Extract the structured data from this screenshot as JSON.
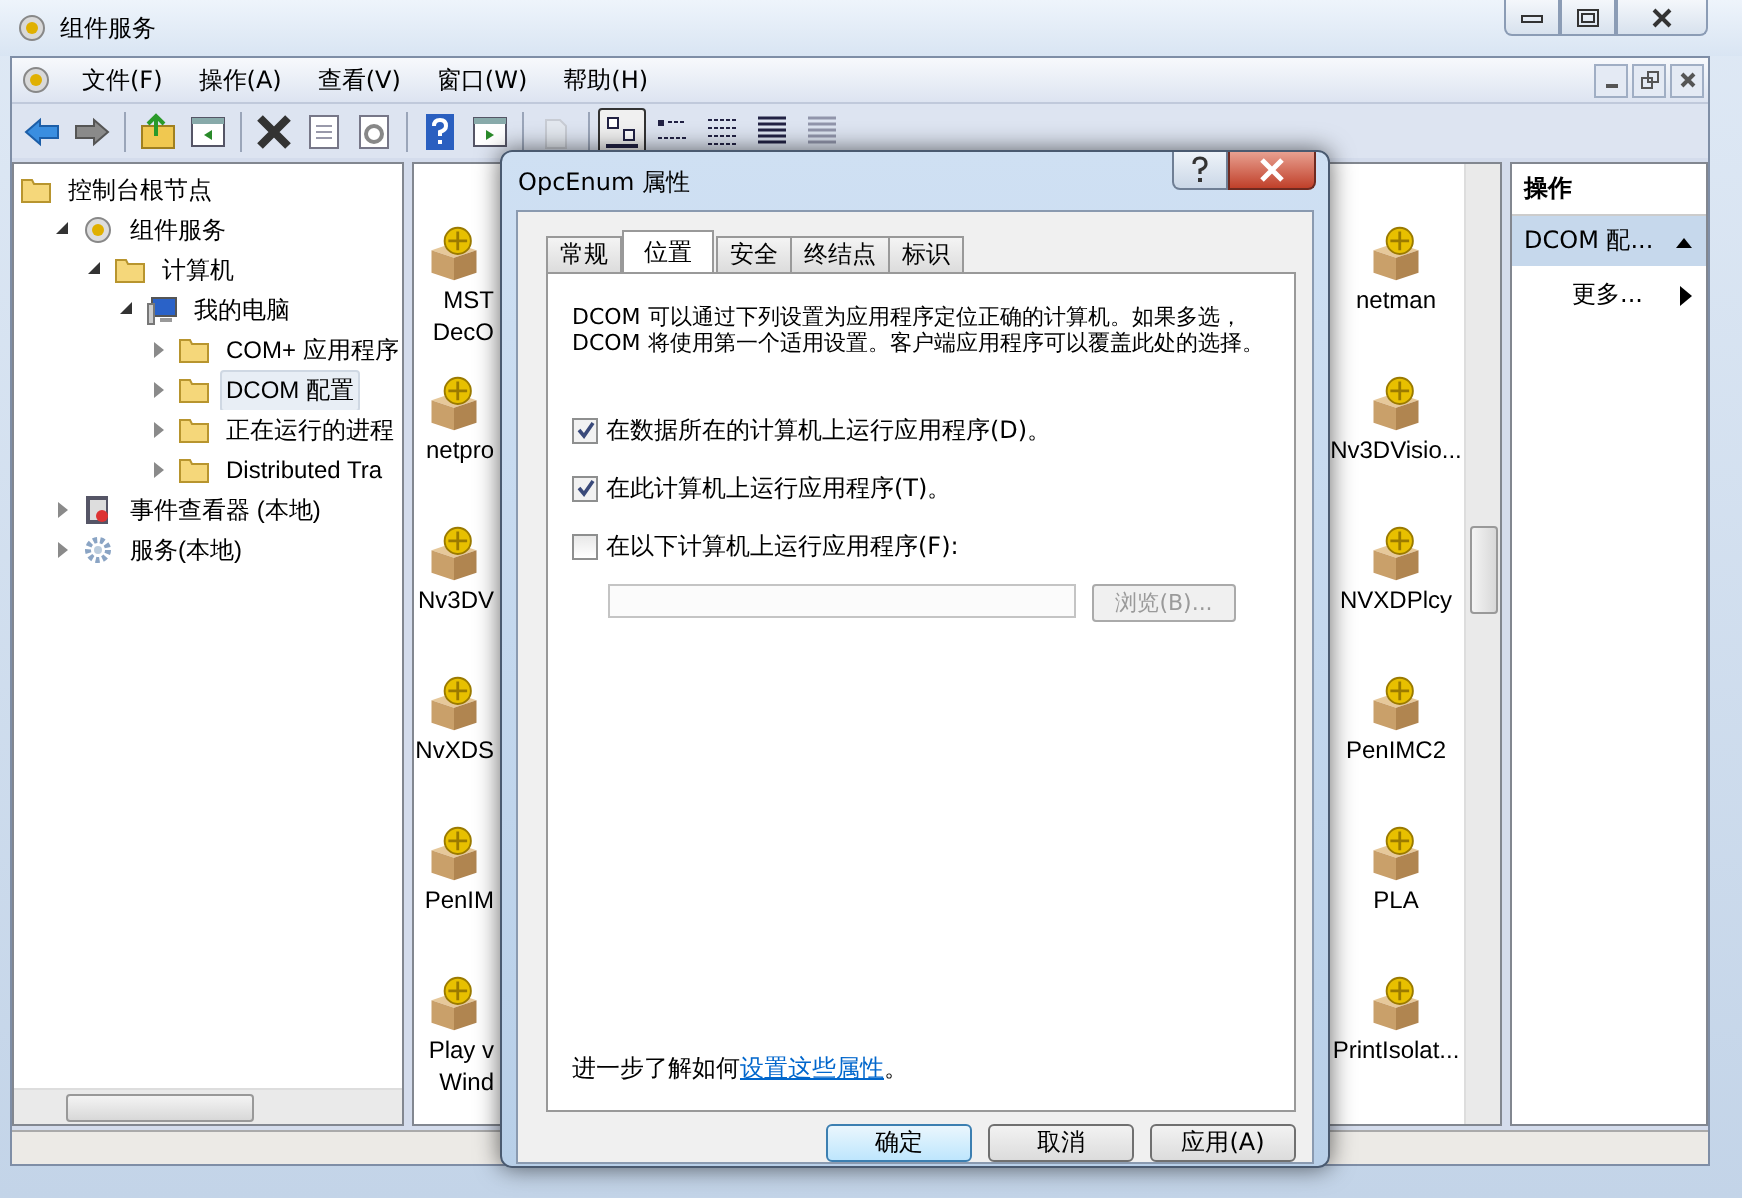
{
  "window": {
    "title": "组件服务"
  },
  "menu": [
    "文件(F)",
    "操作(A)",
    "查看(V)",
    "窗口(W)",
    "帮助(H)"
  ],
  "toolbar": [
    {
      "kind": "back",
      "disabled": false
    },
    {
      "kind": "forward",
      "disabled": false
    },
    {
      "kind": "sep"
    },
    {
      "kind": "up",
      "disabled": false
    },
    {
      "kind": "tree",
      "disabled": false
    },
    {
      "kind": "sep"
    },
    {
      "kind": "delete",
      "disabled": false
    },
    {
      "kind": "properties",
      "disabled": false
    },
    {
      "kind": "refresh",
      "disabled": false
    },
    {
      "kind": "sep"
    },
    {
      "kind": "help",
      "disabled": false
    },
    {
      "kind": "actionpane",
      "disabled": false
    },
    {
      "kind": "sep"
    },
    {
      "kind": "new",
      "disabled": true
    },
    {
      "kind": "sep"
    }
  ],
  "view_buttons": [
    {
      "kind": "large",
      "selected": true,
      "disabled": false
    },
    {
      "kind": "small",
      "selected": false,
      "disabled": false
    },
    {
      "kind": "list",
      "selected": false,
      "disabled": false
    },
    {
      "kind": "detail",
      "selected": false,
      "disabled": false
    },
    {
      "kind": "detail",
      "selected": false,
      "disabled": true
    }
  ],
  "tree": [
    {
      "label": "控制台根节点",
      "kind": "folder",
      "selected": false,
      "children": [
        {
          "label": "组件服务",
          "kind": "component",
          "expanded": true,
          "selected": false,
          "children": [
            {
              "label": "计算机",
              "kind": "folder",
              "expanded": true,
              "selected": false,
              "children": [
                {
                  "label": "我的电脑",
                  "kind": "computer",
                  "expanded": true,
                  "selected": false,
                  "children": [
                    {
                      "label": "COM+ 应用程序",
                      "kind": "folder",
                      "expanded": false,
                      "selected": false
                    },
                    {
                      "label": "DCOM 配置",
                      "kind": "folder",
                      "expanded": false,
                      "selected": true
                    },
                    {
                      "label": "正在运行的进程",
                      "kind": "folder",
                      "expanded": false,
                      "selected": false
                    },
                    {
                      "label": "Distributed Tra",
                      "kind": "folder",
                      "expanded": false,
                      "selected": false
                    }
                  ]
                }
              ]
            }
          ]
        },
        {
          "label": "事件查看器 (本地)",
          "kind": "eventlog",
          "expanded": false,
          "selected": false
        },
        {
          "label": "服务(本地)",
          "kind": "services",
          "expanded": false,
          "selected": false
        }
      ]
    }
  ],
  "icons_left": [
    "MST\nDecO",
    "netpro",
    "Nv3DV",
    "NvXDS",
    "PenIM",
    "Play v\nWind"
  ],
  "icons_right": [
    "netman",
    "Nv3DVisio...",
    "NVXDPlcy",
    "PenIMC2",
    "PLA",
    "PrintIsolat..."
  ],
  "actions": {
    "header": "操作",
    "section": "DCOM 配...",
    "items": [
      "更多..."
    ]
  },
  "dialog": {
    "title": "OpcEnum 属性",
    "tabs": [
      {
        "label": "常规",
        "selected": false
      },
      {
        "label": "位置",
        "selected": true
      },
      {
        "label": "安全",
        "selected": false
      },
      {
        "label": "终结点",
        "selected": false
      },
      {
        "label": "标识",
        "selected": false
      }
    ],
    "description": "DCOM 可以通过下列设置为应用程序定位正确的计算机。如果多选，DCOM 将使用第一个适用设置。客户端应用程序可以覆盖此处的选择。",
    "options": [
      {
        "label": "在数据所在的计算机上运行应用程序(D)。",
        "checked": true
      },
      {
        "label": "在此计算机上运行应用程序(T)。",
        "checked": true
      },
      {
        "label": "在以下计算机上运行应用程序(F):",
        "checked": false
      }
    ],
    "computer_field": {
      "disabled": true
    },
    "browse_button": {
      "label": "浏览(B)...",
      "disabled": true
    },
    "footer_text": "进一步了解如何",
    "footer_link": "设置这些属性",
    "footer_end": "。",
    "buttons": [
      {
        "label": "确定",
        "default": true
      },
      {
        "label": "取消",
        "default": false
      },
      {
        "label": "应用(A)",
        "default": false
      }
    ]
  }
}
